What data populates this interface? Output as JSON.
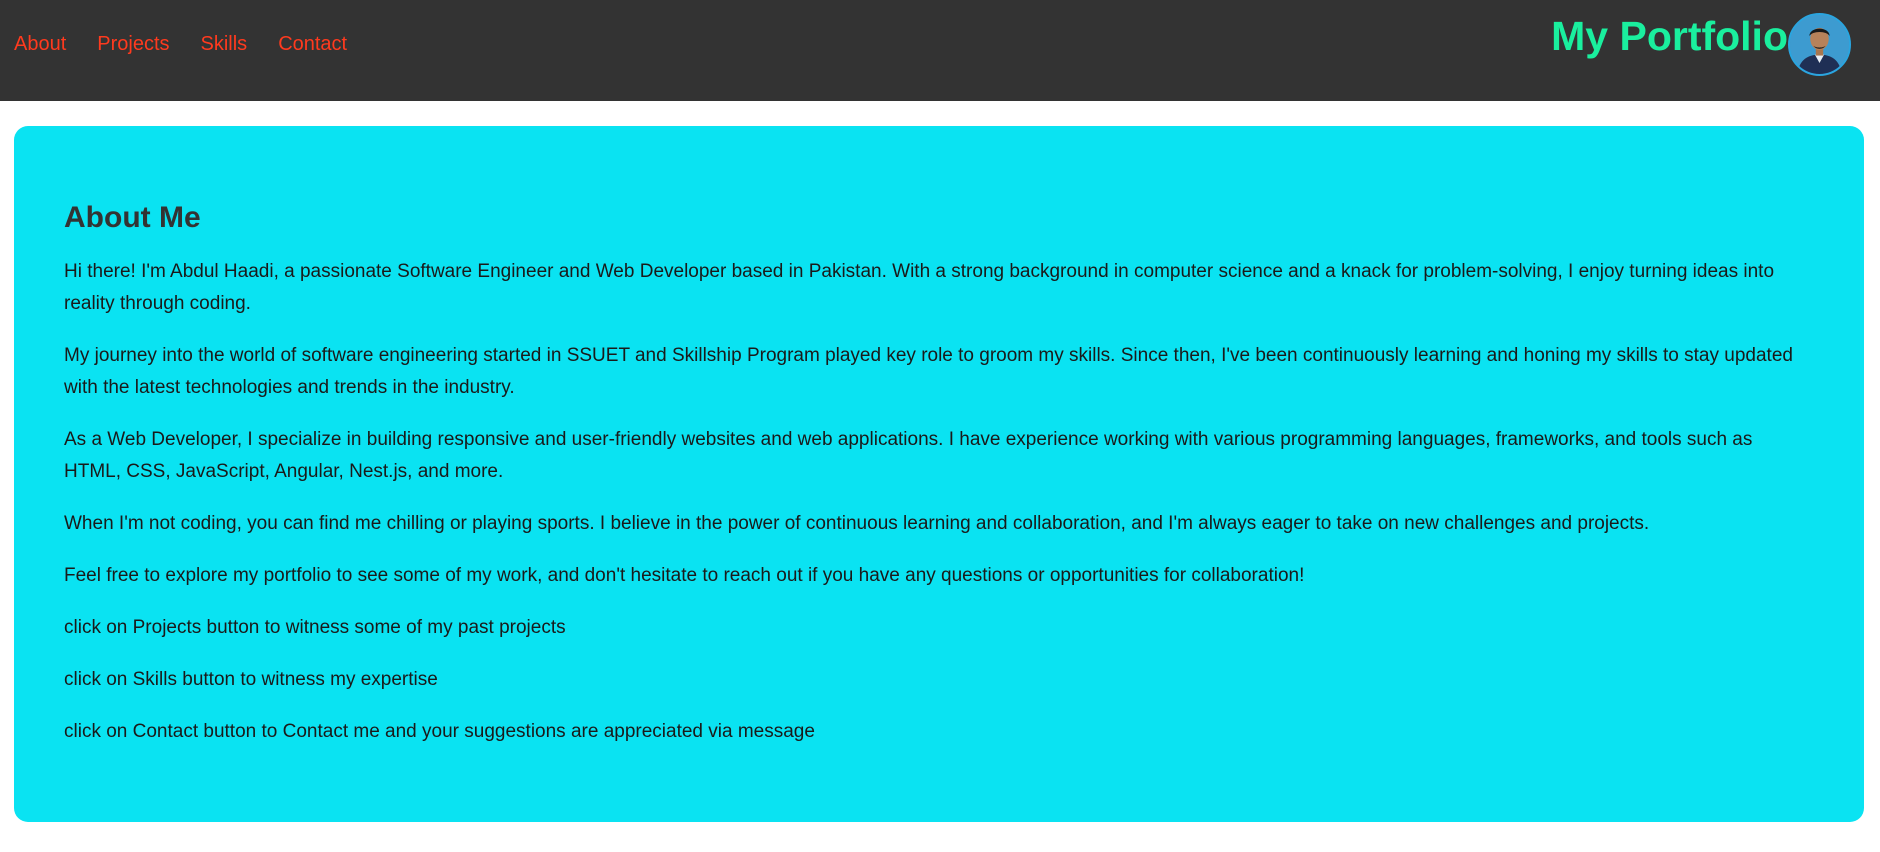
{
  "header": {
    "nav": [
      {
        "label": "About"
      },
      {
        "label": "Projects"
      },
      {
        "label": "Skills"
      },
      {
        "label": "Contact"
      }
    ],
    "brand_title": "My Portfolio",
    "avatar_icon": "profile-photo",
    "colors": {
      "bar_bg": "#333333",
      "nav_link": "#ff3a1e",
      "brand": "#1aef9e"
    }
  },
  "about": {
    "heading": "About Me",
    "paragraphs": [
      "Hi there! I'm Abdul Haadi, a passionate Software Engineer and Web Developer based in Pakistan. With a strong background in computer science and a knack for problem-solving, I enjoy turning ideas into reality through coding.",
      "My journey into the world of software engineering started in SSUET and Skillship Program played key role to groom my skills. Since then, I've been continuously learning and honing my skills to stay updated with the latest technologies and trends in the industry.",
      "As a Web Developer, I specialize in building responsive and user-friendly websites and web applications. I have experience working with various programming languages, frameworks, and tools such as HTML, CSS, JavaScript, Angular, Nest.js, and more.",
      "When I'm not coding, you can find me chilling or playing sports. I believe in the power of continuous learning and collaboration, and I'm always eager to take on new challenges and projects.",
      "Feel free to explore my portfolio to see some of my work, and don't hesitate to reach out if you have any questions or opportunities for collaboration!",
      "click on Projects button to witness some of my past projects",
      "click on Skills button to witness my expertise",
      "click on Contact button to Contact me and your suggestions are appreciated via message"
    ],
    "card_color": "#0ae3f2"
  }
}
